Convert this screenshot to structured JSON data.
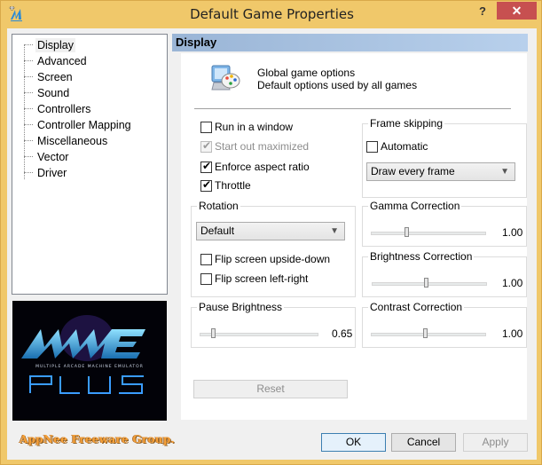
{
  "window": {
    "title": "Default Game Properties",
    "help_label": "?",
    "close_label": "✕"
  },
  "tree": {
    "items": [
      {
        "label": "Display",
        "selected": true
      },
      {
        "label": "Advanced"
      },
      {
        "label": "Screen"
      },
      {
        "label": "Sound"
      },
      {
        "label": "Controllers"
      },
      {
        "label": "Controller Mapping"
      },
      {
        "label": "Miscellaneous"
      },
      {
        "label": "Vector"
      },
      {
        "label": "Driver"
      }
    ]
  },
  "logo": {
    "title": "MAME",
    "subtitle": "MULTIPLE ARCADE MACHINE EMULATOR",
    "plus": "PLUS"
  },
  "watermark": "AppNee Freeware Group.",
  "page": {
    "header": "Display",
    "description_line1": "Global game options",
    "description_line2": "Default options used by all games"
  },
  "options": {
    "run_in_window": {
      "label": "Run in a window",
      "checked": false,
      "enabled": true
    },
    "start_maximized": {
      "label": "Start out maximized",
      "checked": true,
      "enabled": false
    },
    "enforce_aspect": {
      "label": "Enforce aspect ratio",
      "checked": true,
      "enabled": true
    },
    "throttle": {
      "label": "Throttle",
      "checked": true,
      "enabled": true
    }
  },
  "frame_skipping": {
    "legend": "Frame skipping",
    "automatic": {
      "label": "Automatic",
      "checked": false
    },
    "selected": "Draw every frame"
  },
  "rotation": {
    "legend": "Rotation",
    "selected": "Default",
    "flip_upside_down": {
      "label": "Flip screen upside-down",
      "checked": false
    },
    "flip_left_right": {
      "label": "Flip screen left-right",
      "checked": false
    }
  },
  "sliders": {
    "gamma": {
      "legend": "Gamma Correction",
      "value": "1.00",
      "fraction": 0.3
    },
    "brightness": {
      "legend": "Brightness Correction",
      "value": "1.00",
      "fraction": 0.47
    },
    "contrast": {
      "legend": "Contrast Correction",
      "value": "1.00",
      "fraction": 0.47
    },
    "pause_brightness": {
      "legend": "Pause Brightness",
      "value": "0.65",
      "fraction": 0.1
    }
  },
  "buttons": {
    "reset": "Reset",
    "ok": "OK",
    "cancel": "Cancel",
    "apply": "Apply"
  }
}
